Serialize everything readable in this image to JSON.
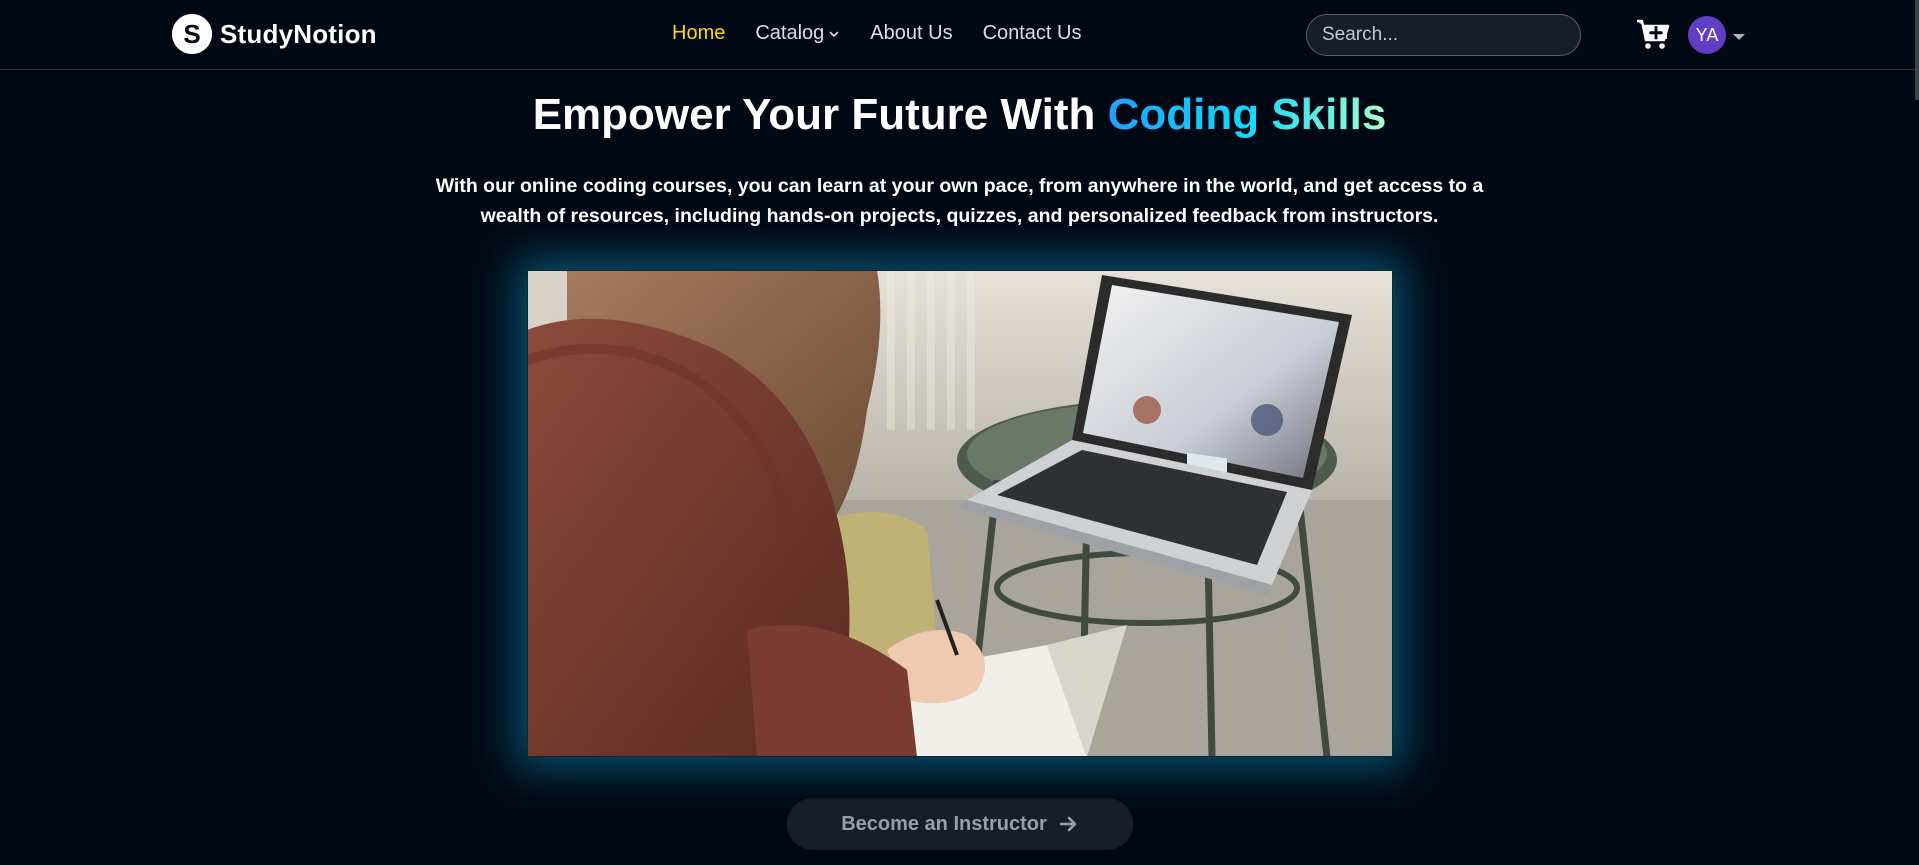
{
  "brand": {
    "name": "StudyNotion",
    "logo_letter": "S"
  },
  "nav": {
    "links": [
      {
        "label": "Home",
        "active": true
      },
      {
        "label": "Catalog",
        "has_dropdown": true
      },
      {
        "label": "About Us"
      },
      {
        "label": "Contact Us"
      }
    ]
  },
  "search": {
    "placeholder": "Search...",
    "value": ""
  },
  "user": {
    "initials": "YA",
    "avatar_color": "#5F3DC4"
  },
  "icons": {
    "cart": "cart-plus-icon",
    "caret": "caret-down-icon",
    "catalog_caret": "chevron-down-icon",
    "cta_arrow": "arrow-right-icon"
  },
  "hero": {
    "title_prefix": "Empower Your Future With ",
    "title_highlight": "Coding Skills",
    "subtitle": "With our online coding courses, you can learn at your own pace, from anywhere in the world, and get access to a wealth of resources, including hands-on projects, quizzes, and personalized feedback from instructors."
  },
  "cta": {
    "label": "Become an Instructor"
  },
  "colors": {
    "background": "#000814",
    "active_link": "#FFD60A",
    "highlight_gradient": [
      "#1FA2FF",
      "#12D8FA",
      "#A6FFCB"
    ],
    "glow": "#118AB2",
    "button_bg": "#161D29"
  }
}
